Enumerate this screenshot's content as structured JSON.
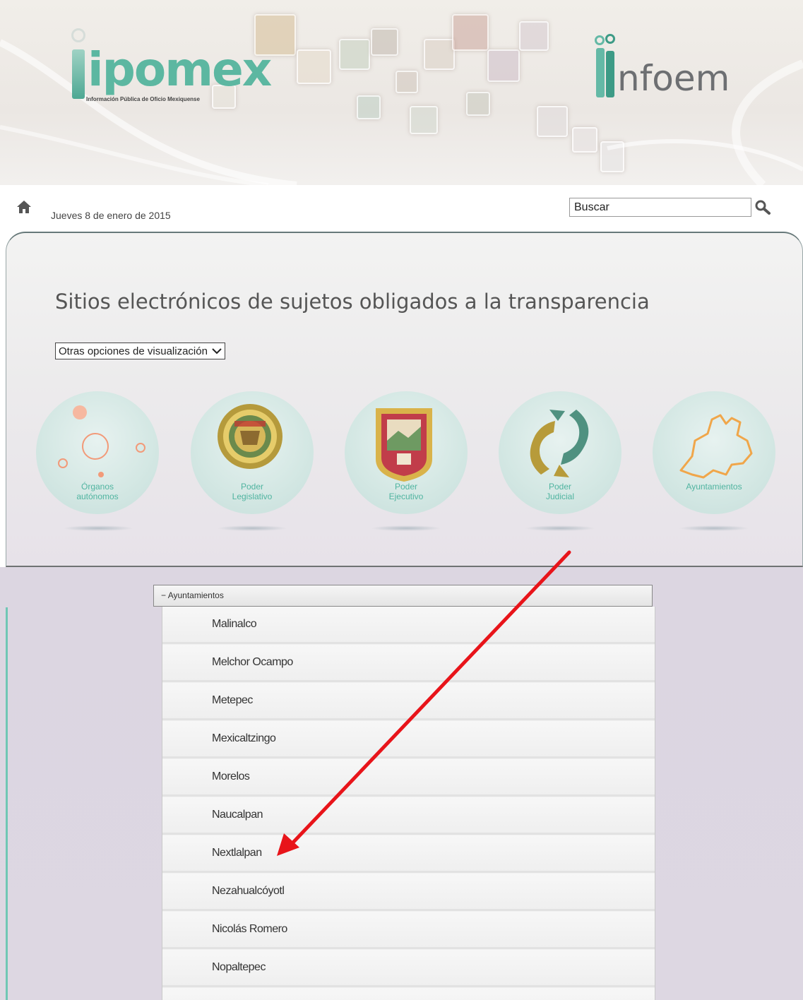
{
  "header": {
    "logo_left": "ipomex",
    "logo_left_tagline": "Información Pública de Oficio Mexiquense",
    "logo_right": "nfoem"
  },
  "nav": {
    "home_icon": "home-icon",
    "date": "Jueves 8 de enero de 2015",
    "search_placeholder": "Buscar",
    "search_icon": "search-icon"
  },
  "main": {
    "title": "Sitios electrónicos de sujetos obligados a la transparencia",
    "view_select": "Otras opciones de visualización",
    "categories": [
      {
        "line1": "Órganos",
        "line2": "autónomos"
      },
      {
        "line1": "Poder",
        "line2": "Legislativo"
      },
      {
        "line1": "Poder",
        "line2": "Ejecutivo"
      },
      {
        "line1": "Poder",
        "line2": "Judicial"
      },
      {
        "line1": "",
        "line2": "Ayuntamientos"
      }
    ]
  },
  "accordion": {
    "toggle": "−",
    "title": "Ayuntamientos",
    "items": [
      "Malinalco",
      "Melchor Ocampo",
      "Metepec",
      "Mexicaltzingo",
      "Morelos",
      "Naucalpan",
      "Nextlalpan",
      "Nezahualcóyotl",
      "Nicolás Romero",
      "Nopaltepec"
    ]
  },
  "annotation": {
    "arrow_color": "#e8141a"
  },
  "colors": {
    "accent": "#50b4a0",
    "logo_green": "#5cb7a1",
    "text_gray": "#6d6f72"
  }
}
